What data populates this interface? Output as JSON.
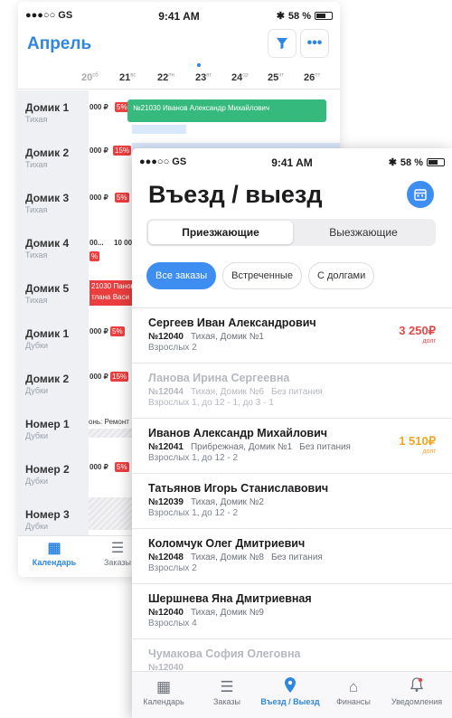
{
  "back": {
    "status": {
      "carrier": "●●●○○ GS",
      "time": "9:41 AM",
      "battery": "58 %"
    },
    "title": "Апрель",
    "filter_icon": "filter-icon",
    "more_icon": "more-icon",
    "days": [
      {
        "num": "20",
        "dow": "сб"
      },
      {
        "num": "21",
        "dow": "вс"
      },
      {
        "num": "22",
        "dow": "пн"
      },
      {
        "num": "23",
        "dow": "вт"
      },
      {
        "num": "24",
        "dow": "ср"
      },
      {
        "num": "25",
        "dow": "чт"
      },
      {
        "num": "26",
        "dow": "пт"
      }
    ],
    "rooms": [
      {
        "name": "Домик 1",
        "sub": "Тихая"
      },
      {
        "name": "Домик 2",
        "sub": "Тихая"
      },
      {
        "name": "Домик 3",
        "sub": "Тихая"
      },
      {
        "name": "Домик 4",
        "sub": "Тихая"
      },
      {
        "name": "Домик 5",
        "sub": "Тихая"
      },
      {
        "name": "Домик 1",
        "sub": "Дубки"
      },
      {
        "name": "Домик 2",
        "sub": "Дубки"
      },
      {
        "name": "Номер 1",
        "sub": "Дубки"
      },
      {
        "name": "Номер 2",
        "sub": "Дубки"
      },
      {
        "name": "Номер 3",
        "sub": "Дубки"
      }
    ],
    "cells": {
      "r1_price": "000 ₽",
      "r1_pct": "5%",
      "r1_booking": "№21030 Иванов Александр Михайлович",
      "r2_price": "000 ₽",
      "r2_pct": "15%",
      "r3_price": "000 ₽",
      "r3_pct": "5%",
      "r4_a": "00...",
      "r4_b": "10 00",
      "r4_pct": "%",
      "r5_line1": "21030 Панов",
      "r5_line2": "тлана Васи",
      "r6_price": "000 ₽",
      "r6_pct": "5%",
      "r7_price": "000 ₽",
      "r7_pct": "15%",
      "r8_repair": "онь: Ремонт",
      "r9_price": "000 ₽",
      "r9_pct": "5%"
    },
    "tabs": [
      {
        "label": "Календарь",
        "icon": "calendar-icon"
      },
      {
        "label": "Заказы",
        "icon": "orders-icon"
      }
    ]
  },
  "front": {
    "status": {
      "carrier": "●●●○○ GS",
      "time": "9:41 AM",
      "battery": "58 %"
    },
    "title": "Въезд / выезд",
    "calendar_icon": "calendar-icon",
    "segments": [
      "Приезжающие",
      "Выезжающие"
    ],
    "chips": [
      "Все заказы",
      "Встреченные",
      "С долгами"
    ],
    "items": [
      {
        "name": "Сергеев Иван Александрович",
        "num": "№12040",
        "place": "Тихая, Домик №1",
        "food": "",
        "guests": "Взрослых 2",
        "debt": "3 250₽",
        "debt_label": "долг",
        "faded": false
      },
      {
        "name": "Ланова Ирина Сергеевна",
        "num": "№12044",
        "place": "Тихая, Домик №6",
        "food": "Без питания",
        "guests": "Взрослых 1, до 12 - 1, до 3 - 1",
        "debt": "",
        "debt_label": "",
        "faded": true
      },
      {
        "name": "Иванов Александр Михайлович",
        "num": "№12041",
        "place": "Прибрежная, Домик №1",
        "food": "Без питания",
        "guests": "Взрослых 1, до 12 - 2",
        "debt": "1 510₽",
        "debt_label": "долг",
        "faded": false
      },
      {
        "name": "Татьянов Игорь Станиславович",
        "num": "№12039",
        "place": "Тихая, Домик №2",
        "food": "",
        "guests": "Взрослых 1, до 12 - 2",
        "debt": "",
        "debt_label": "",
        "faded": false
      },
      {
        "name": "Коломчук Олег Дмитриевич",
        "num": "№12048",
        "place": "Тихая, Домик №8",
        "food": "Без питания",
        "guests": "Взрослых 2",
        "debt": "",
        "debt_label": "",
        "faded": false
      },
      {
        "name": "Шершнева Яна Дмитриевная",
        "num": "№12040",
        "place": "Тихая, Домик №9",
        "food": "",
        "guests": "Взрослых 4",
        "debt": "",
        "debt_label": "",
        "faded": false
      },
      {
        "name": "Чумакова София Олеговна",
        "num": "№12040",
        "place": "",
        "food": "",
        "guests": "",
        "debt": "",
        "debt_label": "",
        "faded": true
      }
    ],
    "tabs": [
      {
        "label": "Календарь",
        "icon": "calendar-icon"
      },
      {
        "label": "Заказы",
        "icon": "orders-icon"
      },
      {
        "label": "Въезд / Выезд",
        "icon": "location-pin-icon"
      },
      {
        "label": "Финансы",
        "icon": "finance-icon"
      },
      {
        "label": "Уведомления",
        "icon": "bell-icon"
      }
    ],
    "colors": {
      "accent": "#3d8ef0",
      "debt_red": "#e54848",
      "debt_orange": "#f0a521",
      "booking_green": "#35b97c"
    }
  }
}
